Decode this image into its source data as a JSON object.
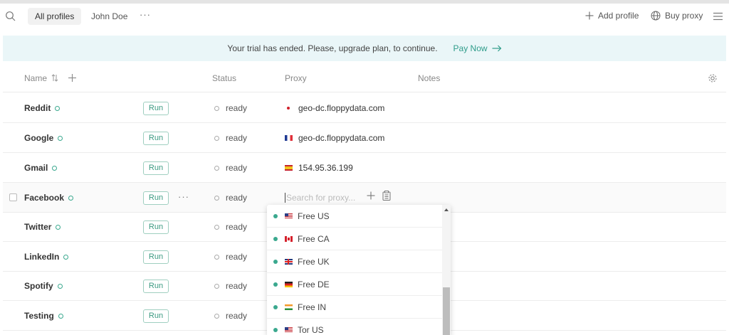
{
  "topbar": {
    "tabs": [
      {
        "label": "All profiles",
        "active": true
      },
      {
        "label": "John Doe",
        "active": false
      }
    ],
    "more": "···",
    "add_profile": "Add profile",
    "buy_proxy": "Buy proxy"
  },
  "banner": {
    "message": "Your trial has ended. Please, upgrade plan, to continue.",
    "pay_now": "Pay Now"
  },
  "table": {
    "columns": {
      "name": "Name",
      "status": "Status",
      "proxy": "Proxy",
      "notes": "Notes"
    },
    "rows": [
      {
        "name": "Reddit",
        "run": "Run",
        "status": "ready",
        "proxy": "geo-dc.floppydata.com",
        "flag": "jp"
      },
      {
        "name": "Google",
        "run": "Run",
        "status": "ready",
        "proxy": "geo-dc.floppydata.com",
        "flag": "fr"
      },
      {
        "name": "Gmail",
        "run": "Run",
        "status": "ready",
        "proxy": "154.95.36.199",
        "flag": "es"
      },
      {
        "name": "Facebook",
        "run": "Run",
        "status": "ready",
        "proxy": "",
        "flag": ""
      },
      {
        "name": "Twitter",
        "run": "Run",
        "status": "ready",
        "proxy": "",
        "flag": ""
      },
      {
        "name": "LinkedIn",
        "run": "Run",
        "status": "ready",
        "proxy": "",
        "flag": ""
      },
      {
        "name": "Spotify",
        "run": "Run",
        "status": "ready",
        "proxy": "",
        "flag": ""
      },
      {
        "name": "Testing",
        "run": "Run",
        "status": "ready",
        "proxy": "",
        "flag": ""
      }
    ],
    "row_more": "···",
    "proxy_search_placeholder": "Search for proxy..."
  },
  "proxy_dropdown": {
    "items": [
      {
        "label": "Free US",
        "flag": "us"
      },
      {
        "label": "Free CA",
        "flag": "ca"
      },
      {
        "label": "Free UK",
        "flag": "uk"
      },
      {
        "label": "Free DE",
        "flag": "de"
      },
      {
        "label": "Free IN",
        "flag": "in"
      },
      {
        "label": "Tor US",
        "flag": "us"
      }
    ]
  },
  "colors": {
    "accent": "#2e9c8a",
    "banner_bg": "#eaf6f8",
    "online_dot": "#3aa88e"
  }
}
